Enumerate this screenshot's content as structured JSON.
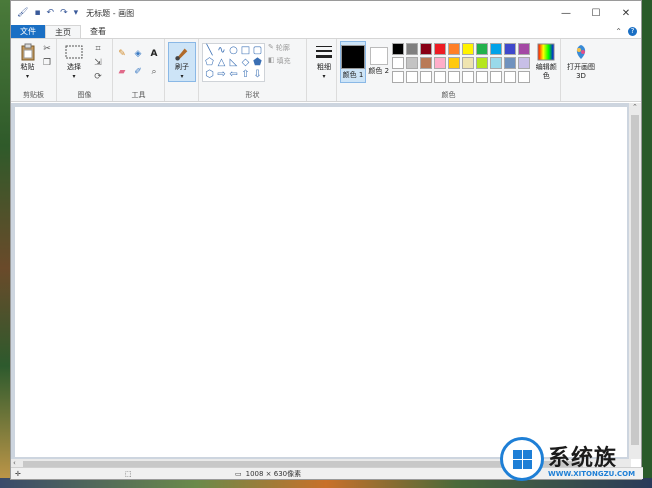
{
  "title_bar": {
    "title": "无标题 - 画图",
    "controls": [
      "—",
      "☐",
      "✕"
    ]
  },
  "tabs": [
    {
      "label": "文件"
    },
    {
      "label": "主页"
    },
    {
      "label": "查看"
    }
  ],
  "ribbon": {
    "clipboard": {
      "paste_label": "粘贴",
      "group_label": "剪贴板"
    },
    "image": {
      "select_label": "选择",
      "group_label": "图像"
    },
    "tools": {
      "group_label": "工具"
    },
    "brushes": {
      "label": "刷子"
    },
    "shapes": {
      "outline_label": "轮廓",
      "fill_label": "填充",
      "group_label": "形状"
    },
    "size": {
      "label": "粗细"
    },
    "colors": {
      "color1_label": "颜色 1",
      "color2_label": "颜色 2",
      "group_label": "颜色",
      "edit_label": "编辑颜色",
      "color1": "#000000",
      "color2": "#ffffff",
      "palette": [
        "#000000",
        "#7f7f7f",
        "#880015",
        "#ed1c24",
        "#ff7f27",
        "#fff200",
        "#22b14c",
        "#00a2e8",
        "#3f48cc",
        "#a349a4",
        "#ffffff",
        "#c3c3c3",
        "#b97a57",
        "#ffaec9",
        "#ffc90e",
        "#efe4b0",
        "#b5e61d",
        "#99d9ea",
        "#7092be",
        "#c8bfe7",
        "#ffffff",
        "#ffffff",
        "#ffffff",
        "#ffffff",
        "#ffffff",
        "#ffffff",
        "#ffffff",
        "#ffffff",
        "#ffffff",
        "#ffffff"
      ]
    },
    "paint3d": {
      "label": "打开画图 3D"
    }
  },
  "status": {
    "image_size": "1008 × 630像素"
  },
  "watermark": {
    "brand": "系统族",
    "url": "WWW.XITONGZU.COM"
  }
}
